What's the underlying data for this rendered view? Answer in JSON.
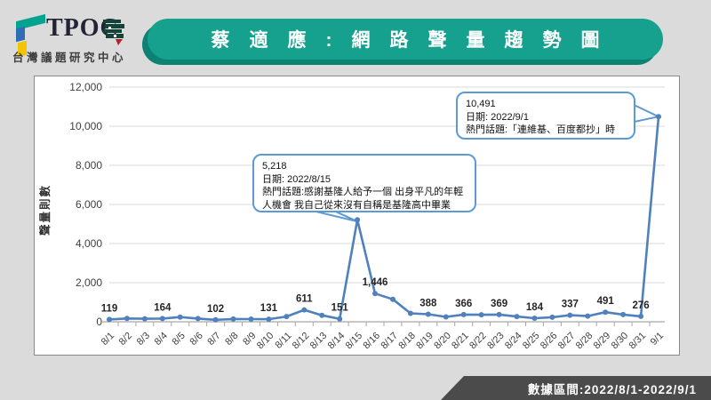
{
  "header": {
    "logo": {
      "brand": "TPOC",
      "subtitle": "台灣議題研究中心"
    },
    "title": "蔡適應:網路聲量趨勢圖"
  },
  "chart_data": {
    "type": "line",
    "title": "蔡適應 網路聲量趨勢圖",
    "ylabel": "聲量則數",
    "xlabel": "",
    "ylim": [
      0,
      12000
    ],
    "yticks": [
      "0",
      "2,000",
      "4,000",
      "6,000",
      "8,000",
      "10,000",
      "12,000"
    ],
    "grid": "horizontal",
    "line_color": "#4F81BD",
    "categories": [
      "8/1",
      "8/2",
      "8/3",
      "8/4",
      "8/5",
      "8/6",
      "8/7",
      "8/8",
      "8/9",
      "8/10",
      "8/11",
      "8/12",
      "8/13",
      "8/14",
      "8/15",
      "8/16",
      "8/17",
      "8/18",
      "8/19",
      "8/20",
      "8/21",
      "8/22",
      "8/23",
      "8/24",
      "8/25",
      "8/26",
      "8/27",
      "8/28",
      "8/29",
      "8/30",
      "8/31",
      "9/1"
    ],
    "values": [
      119,
      170,
      155,
      164,
      240,
      165,
      102,
      140,
      135,
      131,
      270,
      611,
      330,
      151,
      5218,
      1446,
      1150,
      430,
      388,
      250,
      366,
      360,
      369,
      270,
      184,
      230,
      337,
      290,
      491,
      370,
      276,
      10491
    ],
    "labels": [
      "119",
      "",
      "",
      "164",
      "",
      "",
      "102",
      "",
      "",
      "131",
      "",
      "611",
      "",
      "151",
      "",
      "1,446",
      "",
      "",
      "388",
      "",
      "366",
      "",
      "369",
      "",
      "184",
      "",
      "337",
      "",
      "491",
      "",
      "276",
      ""
    ],
    "annotations": [
      {
        "value": "5,218",
        "date": "日期: 2022/8/15",
        "topic": "熱門話題:感謝基隆人給予一個 出身平凡的年輕人機會 我自己從來沒有自稱是基隆高中畢業",
        "target_category": "8/15"
      },
      {
        "value": "10,491",
        "date": "日期: 2022/9/1",
        "topic": "熱門話題:「連維基、百度都抄」時",
        "target_category": "9/1"
      }
    ]
  },
  "footer": {
    "text": "數據區間:2022/8/1-2022/9/1"
  },
  "colors": {
    "banner": "#16a18f",
    "banner_shadow": "#0d8172",
    "line": "#4F81BD",
    "callout_border": "#5B9BD5",
    "footer_bar": "#4b4b4b",
    "background": "#dbdbdb"
  }
}
